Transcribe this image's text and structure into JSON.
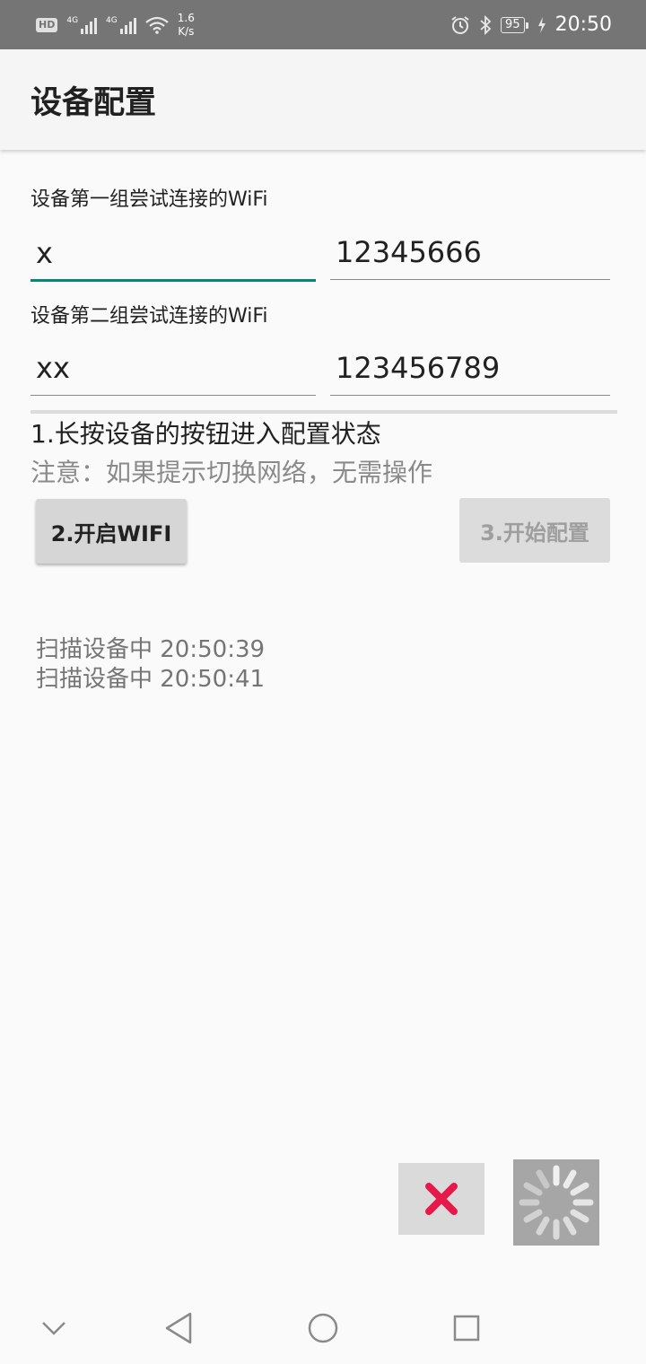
{
  "status_bar": {
    "hd": "HD",
    "signal1_tag": "4G",
    "signal2_tag": "4G",
    "speed_value": "1.6",
    "speed_unit": "K/s",
    "battery": "95",
    "time": "20:50"
  },
  "app_bar": {
    "title": "设备配置"
  },
  "group1": {
    "label": "设备第一组尝试连接的WiFi",
    "ssid": "x",
    "password": "12345666"
  },
  "group2": {
    "label": "设备第二组尝试连接的WiFi",
    "ssid": "xx",
    "password": "123456789"
  },
  "instructions": {
    "step1": "1.长按设备的按钮进入配置状态",
    "note": "注意：如果提示切换网络，无需操作"
  },
  "buttons": {
    "open_wifi": "2.开启WIFI",
    "start_config": "3.开始配置"
  },
  "log": [
    "扫描设备中 20:50:39",
    "扫描设备中 20:50:41"
  ],
  "colors": {
    "accent": "#00897b",
    "cancel_x": "#e6194b"
  }
}
